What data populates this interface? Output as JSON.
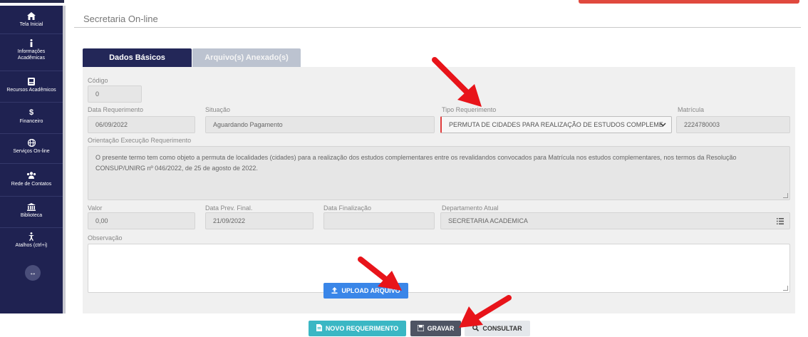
{
  "page": {
    "title": "Secretaria On-line"
  },
  "sidebar": {
    "items": [
      {
        "label": "Tela Inicial",
        "icon": "home-icon"
      },
      {
        "label": "Informações Acadêmicas",
        "icon": "info-icon"
      },
      {
        "label": "Recursos Acadêmicos",
        "icon": "id-card-icon"
      },
      {
        "label": "Financeiro",
        "icon": "dollar-icon"
      },
      {
        "label": "Serviços On-line",
        "icon": "globe-icon"
      },
      {
        "label": "Rede de Contatos",
        "icon": "users-icon"
      },
      {
        "label": "Biblioteca",
        "icon": "bank-icon"
      },
      {
        "label": "Atalhos (ctrl+i)",
        "icon": "accessibility-icon"
      }
    ],
    "toggle_glyph": "↔"
  },
  "tabs": {
    "active": "Dados Básicos",
    "inactive": "Arquivo(s) Anexado(s)"
  },
  "form": {
    "codigo": {
      "label": "Código",
      "value": "0"
    },
    "data_requerimento": {
      "label": "Data Requerimento",
      "value": "06/09/2022"
    },
    "situacao": {
      "label": "Situação",
      "value": "Aguardando Pagamento"
    },
    "tipo_requerimento": {
      "label": "Tipo Requerimento",
      "value": "PERMUTA DE CIDADES PARA REALIZAÇÃO DE ESTUDOS COMPLEME"
    },
    "matricula": {
      "label": "Matrícula",
      "value": "2224780003"
    },
    "orientacao": {
      "label": "Orientação Execução Requerimento",
      "value": "O presente termo tem como objeto a permuta de localidades (cidades) para a realização dos estudos complementares entre os revalidandos convocados para Matrícula nos estudos complementares, nos termos da Resolução CONSUP/UNIRG nº 046/2022, de 25 de agosto de 2022."
    },
    "valor": {
      "label": "Valor",
      "value": "0,00"
    },
    "data_prev_final": {
      "label": "Data Prev. Final.",
      "value": "21/09/2022"
    },
    "data_finalizacao": {
      "label": "Data Finalização",
      "value": ""
    },
    "departamento_atual": {
      "label": "Departamento Atual",
      "value": "SECRETARIA ACADEMICA"
    },
    "observacao": {
      "label": "Observação",
      "value": ""
    }
  },
  "buttons": {
    "upload": "UPLOAD ARQUIVO",
    "novo": "NOVO REQUERIMENTO",
    "gravar": "GRAVAR",
    "consultar": "CONSULTAR"
  },
  "colors": {
    "sidebar": "#1f2251",
    "tab_active": "#232758",
    "upload": "#3a86e8",
    "novo": "#3ab7c4",
    "gravar": "#4e5463",
    "annotation_arrow": "#e8141a"
  }
}
